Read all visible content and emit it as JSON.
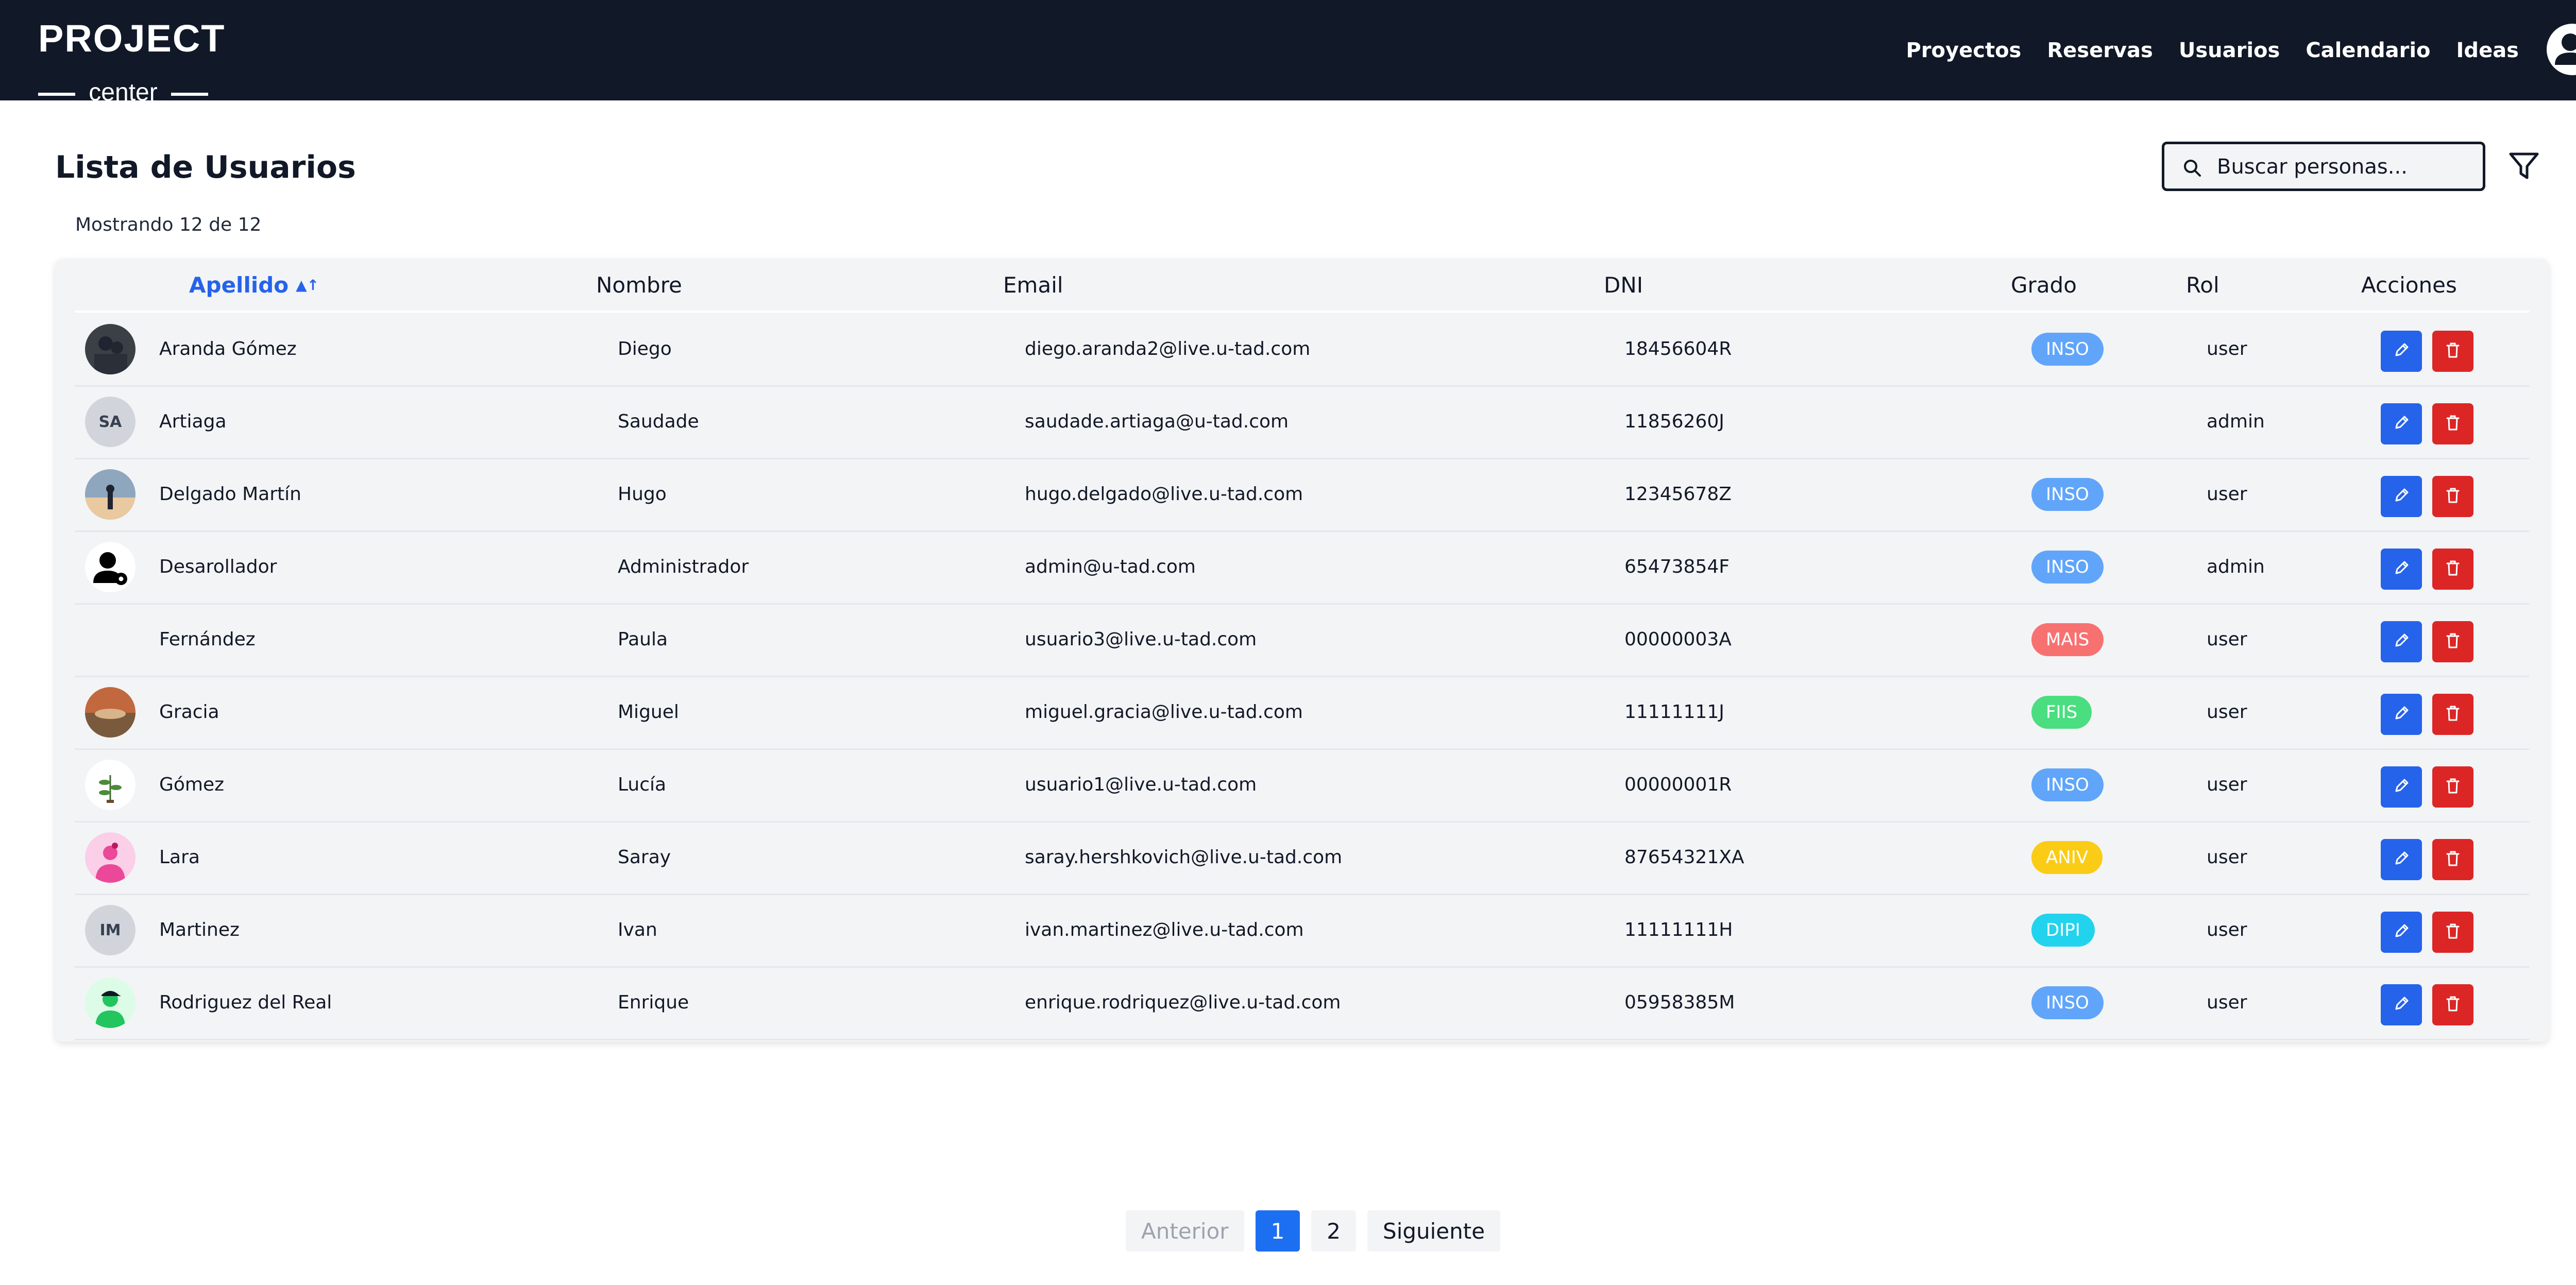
{
  "logo": {
    "top": "PROJECT",
    "bottom": "center"
  },
  "nav": {
    "items": [
      "Proyectos",
      "Reservas",
      "Usuarios",
      "Calendario",
      "Ideas"
    ]
  },
  "page": {
    "title": "Lista de Usuarios",
    "search_placeholder": "Buscar personas...",
    "count_text": "Mostrando 12 de 12"
  },
  "table": {
    "headers": {
      "apellido": "Apellido",
      "nombre": "Nombre",
      "email": "Email",
      "dni": "DNI",
      "grado": "Grado",
      "rol": "Rol",
      "acciones": "Acciones"
    },
    "rows": [
      {
        "apellido": "Aranda Gómez",
        "nombre": "Diego",
        "email": "diego.aranda2@live.u-tad.com",
        "dni": "18456604R",
        "grado": "INSO",
        "rol": "user",
        "avatar": "photo-dark",
        "initials": ""
      },
      {
        "apellido": "Artiaga",
        "nombre": "Saudade",
        "email": "saudade.artiaga@u-tad.com",
        "dni": "11856260J",
        "grado": "",
        "rol": "admin",
        "avatar": "initials",
        "initials": "SA"
      },
      {
        "apellido": "Delgado Martín",
        "nombre": "Hugo",
        "email": "hugo.delgado@live.u-tad.com",
        "dni": "12345678Z",
        "grado": "INSO",
        "rol": "user",
        "avatar": "photo-sunset",
        "initials": ""
      },
      {
        "apellido": "Desarollador",
        "nombre": "Administrador",
        "email": "admin@u-tad.com",
        "dni": "65473854F",
        "grado": "INSO",
        "rol": "admin",
        "avatar": "admin-icon",
        "initials": ""
      },
      {
        "apellido": "Fernández",
        "nombre": "Paula",
        "email": "usuario3@live.u-tad.com",
        "dni": "00000003A",
        "grado": "MAIS",
        "rol": "user",
        "avatar": "none",
        "initials": ""
      },
      {
        "apellido": "Gracia",
        "nombre": "Miguel",
        "email": "miguel.gracia@live.u-tad.com",
        "dni": "11111111J",
        "grado": "FIIS",
        "rol": "user",
        "avatar": "photo-warm",
        "initials": ""
      },
      {
        "apellido": "Gómez",
        "nombre": "Lucía",
        "email": "usuario1@live.u-tad.com",
        "dni": "00000001R",
        "grado": "INSO",
        "rol": "user",
        "avatar": "plant",
        "initials": ""
      },
      {
        "apellido": "Lara",
        "nombre": "Saray",
        "email": "saray.hershkovich@live.u-tad.com",
        "dni": "87654321XA",
        "grado": "ANIV",
        "rol": "user",
        "avatar": "pink-person",
        "initials": ""
      },
      {
        "apellido": "Martinez",
        "nombre": "Ivan",
        "email": "ivan.martinez@live.u-tad.com",
        "dni": "11111111H",
        "grado": "DIPI",
        "rol": "user",
        "avatar": "initials",
        "initials": "IM"
      },
      {
        "apellido": "Rodriguez del Real",
        "nombre": "Enrique",
        "email": "enrique.rodriquez@live.u-tad.com",
        "dni": "05958385M",
        "grado": "INSO",
        "rol": "user",
        "avatar": "green-person",
        "initials": ""
      }
    ]
  },
  "badge_colors": {
    "INSO": "#60a5fa",
    "MAIS": "#f87171",
    "FIIS": "#4ade80",
    "ANIV": "#facc15",
    "DIPI": "#22d3ee"
  },
  "pagination": {
    "prev": "Anterior",
    "pages": [
      "1",
      "2"
    ],
    "next": "Siguiente",
    "current": "1"
  }
}
